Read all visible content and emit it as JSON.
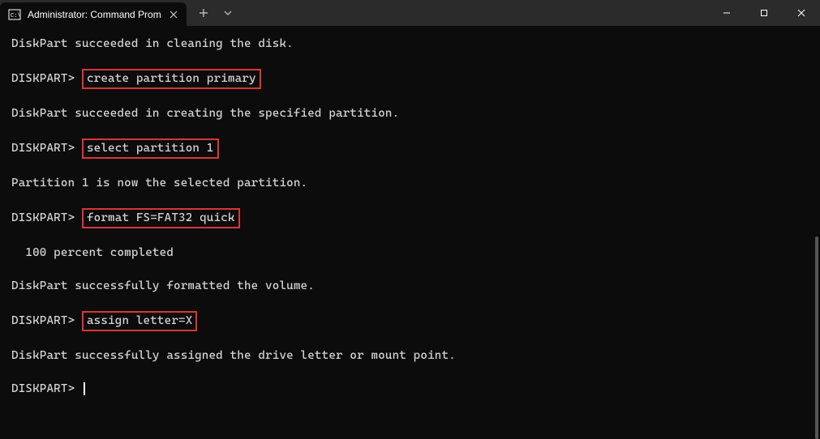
{
  "titlebar": {
    "tab_title": "Administrator: Command Promp",
    "tab_icon_name": "cmd-icon",
    "close_label": "Close",
    "new_tab_label": "New tab",
    "dropdown_label": "Dropdown"
  },
  "window": {
    "minimize_label": "Minimize",
    "maximize_label": "Maximize",
    "close_label": "Close"
  },
  "terminal": {
    "lines": [
      {
        "type": "output",
        "text": "DiskPart succeeded in cleaning the disk."
      },
      {
        "type": "prompt",
        "prompt": "DISKPART>",
        "command": "create partition primary",
        "highlight": true
      },
      {
        "type": "output",
        "text": "DiskPart succeeded in creating the specified partition."
      },
      {
        "type": "prompt",
        "prompt": "DISKPART>",
        "command": "select partition 1",
        "highlight": true
      },
      {
        "type": "output",
        "text": "Partition 1 is now the selected partition."
      },
      {
        "type": "prompt",
        "prompt": "DISKPART>",
        "command": "format FS=FAT32 quick",
        "highlight": true
      },
      {
        "type": "output",
        "text": "  100 percent completed"
      },
      {
        "type": "output",
        "text": "DiskPart successfully formatted the volume."
      },
      {
        "type": "prompt",
        "prompt": "DISKPART>",
        "command": "assign letter=X",
        "highlight": true
      },
      {
        "type": "output",
        "text": "DiskPart successfully assigned the drive letter or mount point."
      },
      {
        "type": "prompt",
        "prompt": "DISKPART>",
        "command": "",
        "cursor": true
      }
    ]
  }
}
